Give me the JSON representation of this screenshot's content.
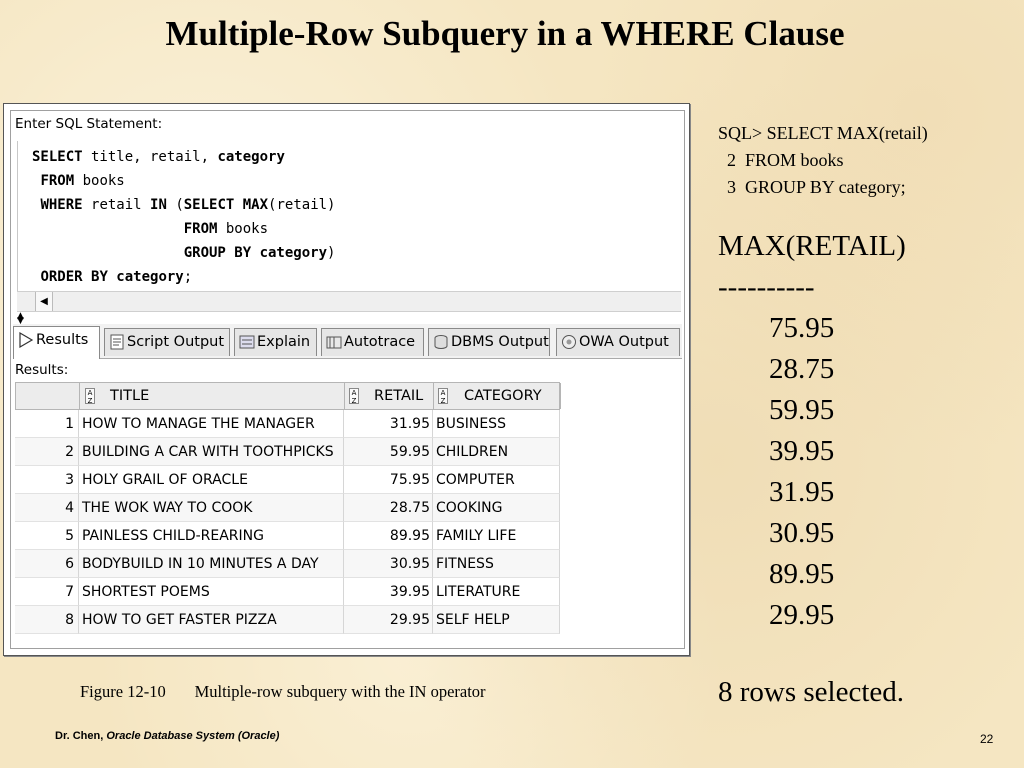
{
  "slide": {
    "title": "Multiple-Row Subquery in a WHERE Clause",
    "caption_figure": "Figure 12-10",
    "caption_text": "Multiple-row subquery with the IN operator",
    "footer_author": "Dr. Chen,",
    "footer_course": "Oracle Database System (Oracle)",
    "page_number": "22"
  },
  "editor": {
    "label": "Enter SQL Statement:",
    "lines": [
      "SELECT title, retail, category",
      " FROM books",
      " WHERE retail IN (SELECT MAX(retail)",
      "                  FROM books",
      "                  GROUP BY category)",
      " ORDER BY category;"
    ]
  },
  "tabs": [
    {
      "label": "Results",
      "icon": "play-icon",
      "active": true
    },
    {
      "label": "Script Output",
      "icon": "script-icon",
      "active": false
    },
    {
      "label": "Explain",
      "icon": "explain-icon",
      "active": false
    },
    {
      "label": "Autotrace",
      "icon": "autotrace-icon",
      "active": false
    },
    {
      "label": "DBMS Output",
      "icon": "dbms-icon",
      "active": false
    },
    {
      "label": "OWA Output",
      "icon": "owa-icon",
      "active": false
    }
  ],
  "results": {
    "label": "Results:",
    "columns": [
      "TITLE",
      "RETAIL",
      "CATEGORY"
    ],
    "rows": [
      {
        "n": "1",
        "title": "HOW TO MANAGE THE MANAGER",
        "retail": "31.95",
        "category": "BUSINESS"
      },
      {
        "n": "2",
        "title": "BUILDING A CAR WITH TOOTHPICKS",
        "retail": "59.95",
        "category": "CHILDREN"
      },
      {
        "n": "3",
        "title": "HOLY GRAIL OF ORACLE",
        "retail": "75.95",
        "category": "COMPUTER"
      },
      {
        "n": "4",
        "title": "THE WOK WAY TO COOK",
        "retail": "28.75",
        "category": "COOKING"
      },
      {
        "n": "5",
        "title": "PAINLESS CHILD-REARING",
        "retail": "89.95",
        "category": "FAMILY LIFE"
      },
      {
        "n": "6",
        "title": "BODYBUILD IN 10 MINUTES A DAY",
        "retail": "30.95",
        "category": "FITNESS"
      },
      {
        "n": "7",
        "title": "SHORTEST POEMS",
        "retail": "39.95",
        "category": "LITERATURE"
      },
      {
        "n": "8",
        "title": "HOW TO GET FASTER PIZZA",
        "retail": "29.95",
        "category": "SELF HELP"
      }
    ]
  },
  "sqlplus": {
    "query_lines": [
      "SQL> SELECT MAX(retail)",
      "  2  FROM books",
      "  3  GROUP BY category;"
    ],
    "column_header": "MAX(RETAIL)",
    "underline": "----------",
    "values": [
      "75.95",
      "28.75",
      "59.95",
      "39.95",
      "31.95",
      "30.95",
      "89.95",
      "29.95"
    ],
    "rows_selected": "8 rows selected."
  }
}
